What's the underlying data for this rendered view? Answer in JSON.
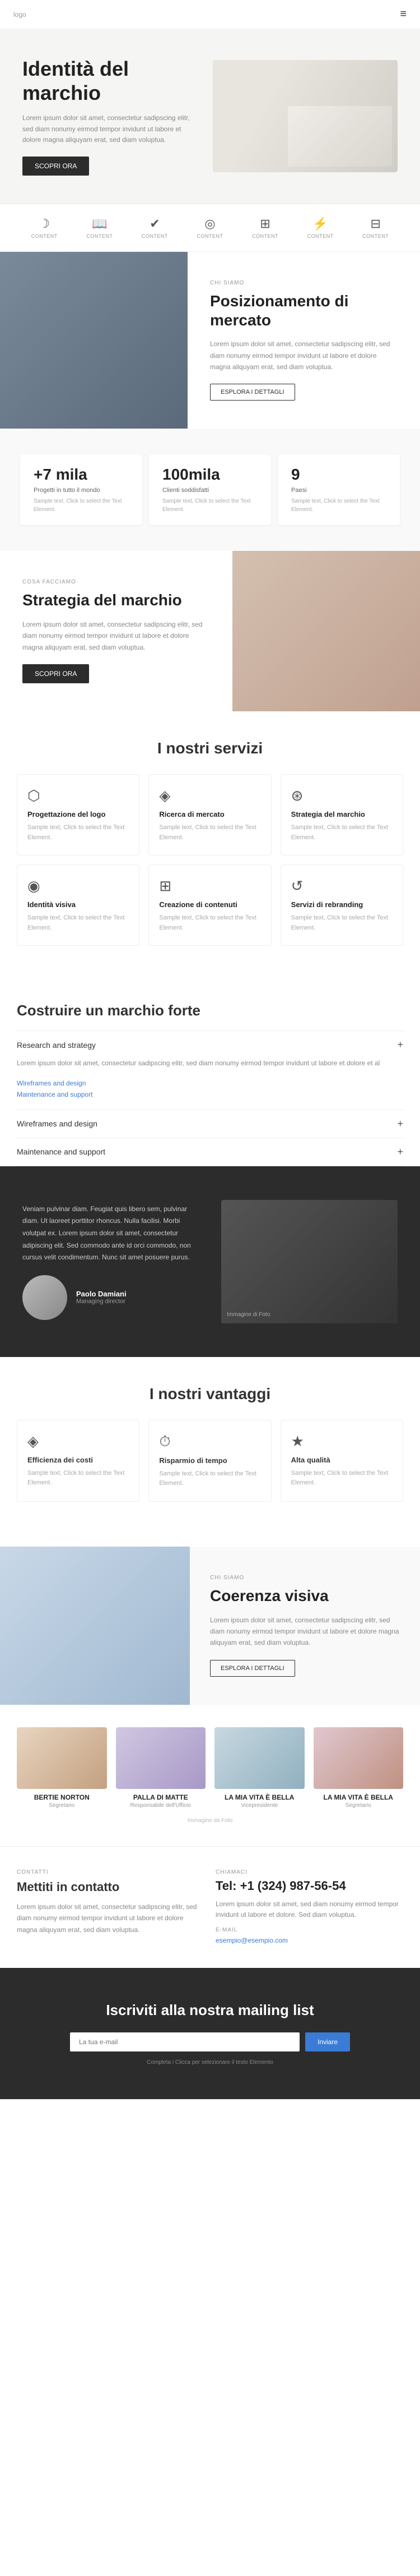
{
  "nav": {
    "logo": "logo",
    "menu_icon": "≡"
  },
  "hero": {
    "title": "Identità del marchio",
    "text": "Lorem ipsum dolor sit amet, consectetur sadipscing elitr, sed diam nonumy eirmod tempor invidunt ut labore et dolore magna aliquyam erat, sed diam voluptua.",
    "button": "SCOPRI ORA"
  },
  "icons_bar": [
    {
      "symbol": "☽",
      "label": "CONTENT"
    },
    {
      "symbol": "📖",
      "label": "CONTENT"
    },
    {
      "symbol": "✔",
      "label": "CONTENT"
    },
    {
      "symbol": "◎",
      "label": "CONTENT"
    },
    {
      "symbol": "⊞",
      "label": "CONTENT"
    },
    {
      "symbol": "⚡",
      "label": "CONTENT"
    },
    {
      "symbol": "⊟",
      "label": "CONTENT"
    }
  ],
  "chi_siamo": {
    "label": "CHI SIAMO",
    "title": "Posizionamento di mercato",
    "text": "Lorem ipsum dolor sit amet, consectetur sadipscing elitr, sed diam nonumy eirmod tempor invidunt ut labore et dolore magna aliquyam erat, sed diam voluptua.",
    "button": "ESPLORA I DETTAGLI"
  },
  "stats": [
    {
      "number": "+7 mila",
      "label": "Progetti in tutto il mondo",
      "desc": "Sample text, Click to select the Text Element."
    },
    {
      "number": "100mila",
      "label": "Clienti soddisfatti",
      "desc": "Sample text, Click to select the Text Element."
    },
    {
      "number": "9",
      "label": "Paesi",
      "desc": "Sample text, Click to select the Text Element."
    }
  ],
  "strategia": {
    "label": "COSA FACCIAMO",
    "title": "Strategia del marchio",
    "text": "Lorem ipsum dolor sit amet, consectetur sadipscing elitr, sed diam nonumy eirmod tempor invidunt ut labore et dolore magna aliquyam erat, sed diam voluptua.",
    "button": "SCOPRI ORA"
  },
  "servizi": {
    "title": "I nostri servizi",
    "items": [
      {
        "icon": "⬡",
        "name": "Progettazione del logo",
        "desc": "Sample text, Click to select the Text Element."
      },
      {
        "icon": "◈",
        "name": "Ricerca di mercato",
        "desc": "Sample text, Click to select the Text Element."
      },
      {
        "icon": "⊛",
        "name": "Strategia del marchio",
        "desc": "Sample text, Click to select the Text Element."
      },
      {
        "icon": "◉",
        "name": "Identità visiva",
        "desc": "Sample text, Click to select the Text Element."
      },
      {
        "icon": "⊞",
        "name": "Creazione di contenuti",
        "desc": "Sample text, Click to select the Text Element."
      },
      {
        "icon": "↺",
        "name": "Servizi di rebranding",
        "desc": "Sample text, Click to select the Text Element."
      }
    ]
  },
  "costruire": {
    "title": "Costruire un marchio forte",
    "accordion": [
      {
        "title": "Research and strategy",
        "open": true,
        "content": "Lorem ipsum dolor sit amet, consectetur sadipscing elitr, sed diam nonumy eirmod tempor invidunt ut labore et dolore et al",
        "links": [
          "Wireframes and design",
          "Maintenance and support"
        ]
      },
      {
        "title": "Wireframes and design",
        "open": false
      },
      {
        "title": "Maintenance and support",
        "open": false
      }
    ]
  },
  "testimonial": {
    "text": "Veniam pulvinar diam. Feugiat quis libero sem, pulvinar diam. Ut laoreet porttitor rhoncus. Nulla facilisi. Morbi volutpat ex. Lorem ipsum dolor sit amet, consectetur adipiscing elit. Sed commodo ante id orci commodo, non cursus velit condimentum. Nunc sit amet posuere purus.",
    "author": "Paolo Damiani",
    "role": "Managing director",
    "image_note": "Immagine di Foto"
  },
  "vantaggi": {
    "title": "I nostri vantaggi",
    "items": [
      {
        "icon": "◈",
        "name": "Efficienza dei costi",
        "desc": "Sample text, Click to select the Text Element."
      },
      {
        "icon": "⏱",
        "name": "Risparmio di tempo",
        "desc": "Sample text, Click to select the Text Element."
      },
      {
        "icon": "★",
        "name": "Alta qualità",
        "desc": "Sample text, Click to select the Text Element."
      }
    ]
  },
  "coerenza": {
    "label": "CHI SIAMO",
    "title": "Coerenza visiva",
    "text": "Lorem ipsum dolor sit amet, consectetur sadipscing elitr, sed diam nonumy eirmod tempor invidunt ut labore et dolore magna aliquyam erat, sed diam voluptua.",
    "button": "ESPLORA I DETTAGLI"
  },
  "team": {
    "members": [
      {
        "name": "BERTIE NORTON",
        "role": "Segretario"
      },
      {
        "name": "PALLA DI MATTE",
        "role": "Responsabile dell'Ufficio"
      },
      {
        "name": "LA MIA VITA È BELLA",
        "role": "Vicepresidente"
      },
      {
        "name": "LA MIA VITA È BELLA",
        "role": "Segretario"
      }
    ],
    "image_note": "Immagine da Foto"
  },
  "contatto": {
    "label": "CONTATTI",
    "title": "Mettiti in contatto",
    "text": "Lorem ipsum dolor sit amet, consectetur sadipscing elitr, sed diam nonumy eirmod tempor invidunt ut labore et dolore magna aliquyam erat, sed diam voluptua.",
    "chiamaci_label": "CHIAMACI",
    "phone": "Tel: +1 (324) 987-56-54",
    "phone_detail": "Lorem ipsum dolor sit amet, sed diam nonumy eirmod tempor invidunt ut labore et dolore. Sed diam voluptua.",
    "email_label": "E-MAIL",
    "email": "esempio@esempio.com"
  },
  "newsletter": {
    "title": "Iscriviti alla nostra mailing list",
    "input_placeholder": "La tua e-mail",
    "button": "Inviare",
    "footer": "Completa i Clicca per selezionare il testo Elemento"
  }
}
